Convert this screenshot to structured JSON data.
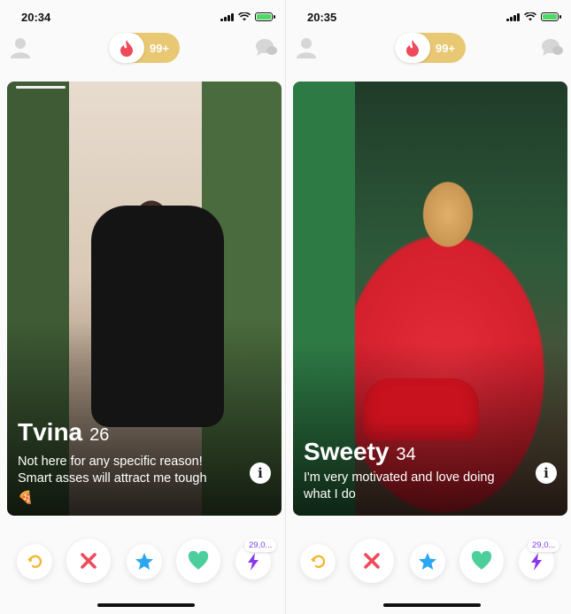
{
  "screens": [
    {
      "status_time": "20:34",
      "gold_count": "99+",
      "card": {
        "name": "Tvina",
        "age": "26",
        "bio": "Not here for any specific reason! Smart asses will attract me tough",
        "emoji": "🍕"
      },
      "boost_count": "29,0..."
    },
    {
      "status_time": "20:35",
      "gold_count": "99+",
      "card": {
        "name": "Sweety",
        "age": "34",
        "bio": "I'm very motivated and love doing what I do"
      },
      "boost_count": "29,0..."
    }
  ],
  "colors": {
    "rewind": "#f5b731",
    "nope": "#ef4a5b",
    "super_like": "#2aa6f2",
    "like": "#4ccf9c",
    "boost": "#8b39e8",
    "gold": "#e9c874",
    "flame": "#ef4a5b"
  },
  "icons": {
    "rewind": "rewind-icon",
    "nope": "close-icon",
    "super_like": "star-icon",
    "like": "heart-icon",
    "boost": "lightning-icon",
    "profile": "profile-icon",
    "messages": "chat-icon",
    "app": "flame-icon",
    "info": "info-icon"
  }
}
